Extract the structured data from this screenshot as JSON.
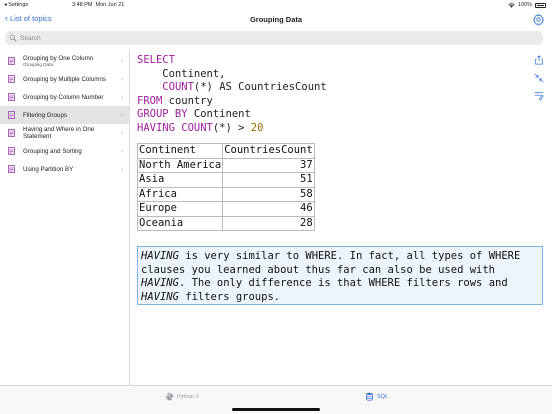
{
  "status": {
    "left": "◂ Settings",
    "time": "3:48 PM",
    "date": "Mon Jun 21",
    "battery": "100%"
  },
  "nav": {
    "back_label": "List of topics",
    "title": "Grouping Data"
  },
  "search": {
    "placeholder": "Search"
  },
  "sidebar": {
    "items": [
      {
        "label": "Grouping by One Column",
        "sub": "Grouping Data"
      },
      {
        "label": "Grouping by Multiple Columns"
      },
      {
        "label": "Grouping by Column Number"
      },
      {
        "label": "Filtering Groups"
      },
      {
        "label": "Having and Where in One Statement"
      },
      {
        "label": "Grouping and Sorting"
      },
      {
        "label": "Using Partition BY"
      }
    ]
  },
  "sql": {
    "l1": "SELECT",
    "l2": "    Continent,",
    "l3_kw": "COUNT",
    "l3_rest": "(*) AS CountriesCount",
    "l4_kw": "FROM",
    "l4_rest": " country",
    "l5_kw": "GROUP BY",
    "l5_rest": " Continent",
    "l6_kw": "HAVING COUNT",
    "l6_rest": "(*) > ",
    "l6_num": "20"
  },
  "result": {
    "headers": [
      "Continent",
      "CountriesCount"
    ],
    "rows": [
      [
        "North America",
        "37"
      ],
      [
        "Asia",
        "51"
      ],
      [
        "Africa",
        "58"
      ],
      [
        "Europe",
        "46"
      ],
      [
        "Oceania",
        "28"
      ]
    ]
  },
  "note": {
    "p1": "HAVING",
    "p2": " is very similar to WHERE. In fact, all types of WHERE clauses you learned about thus far can also be used with ",
    "p3": "HAVING",
    "p4": ". The only difference is that WHERE filters rows and ",
    "p5": "HAVING",
    "p6": " filters groups."
  },
  "tabs": {
    "python": "Python 3",
    "sql": "SQL"
  },
  "colors": {
    "accent": "#2f6fd6",
    "keyword": "#a020a0",
    "number": "#9a6a00",
    "note_bg": "#eef4fc",
    "note_border": "#7fb2e0",
    "selected_row": "#e3e3e6"
  }
}
